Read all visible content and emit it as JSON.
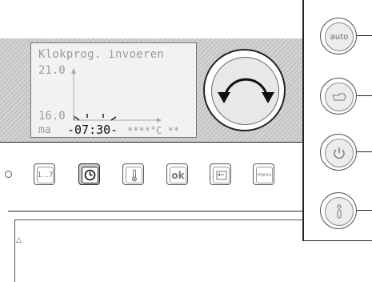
{
  "lcd": {
    "title": "Klokprog. invoeren",
    "y_top": "21.0",
    "y_bottom": "16.0",
    "day": "ma",
    "time": "-07:30-",
    "temp_field": "****°C **"
  },
  "buttons": {
    "days": "1...7",
    "ok": "ok",
    "menu": "menu"
  },
  "side_buttons": {
    "auto": "auto"
  },
  "icons": {
    "rotary": "rotate-arrows-icon",
    "clock": "clock-icon",
    "thermometer": "thermometer-icon",
    "back": "back-arrow-icon",
    "hand": "manual-hand-icon",
    "power": "power-icon",
    "info": "info-icon",
    "warning": "warning-triangle-icon"
  },
  "colors": {
    "lcd_background": "#f2f2f2",
    "lcd_text": "#9a9a9a",
    "housing_hatch": "#c8c8c8",
    "active_button": "#d0d0d0"
  }
}
